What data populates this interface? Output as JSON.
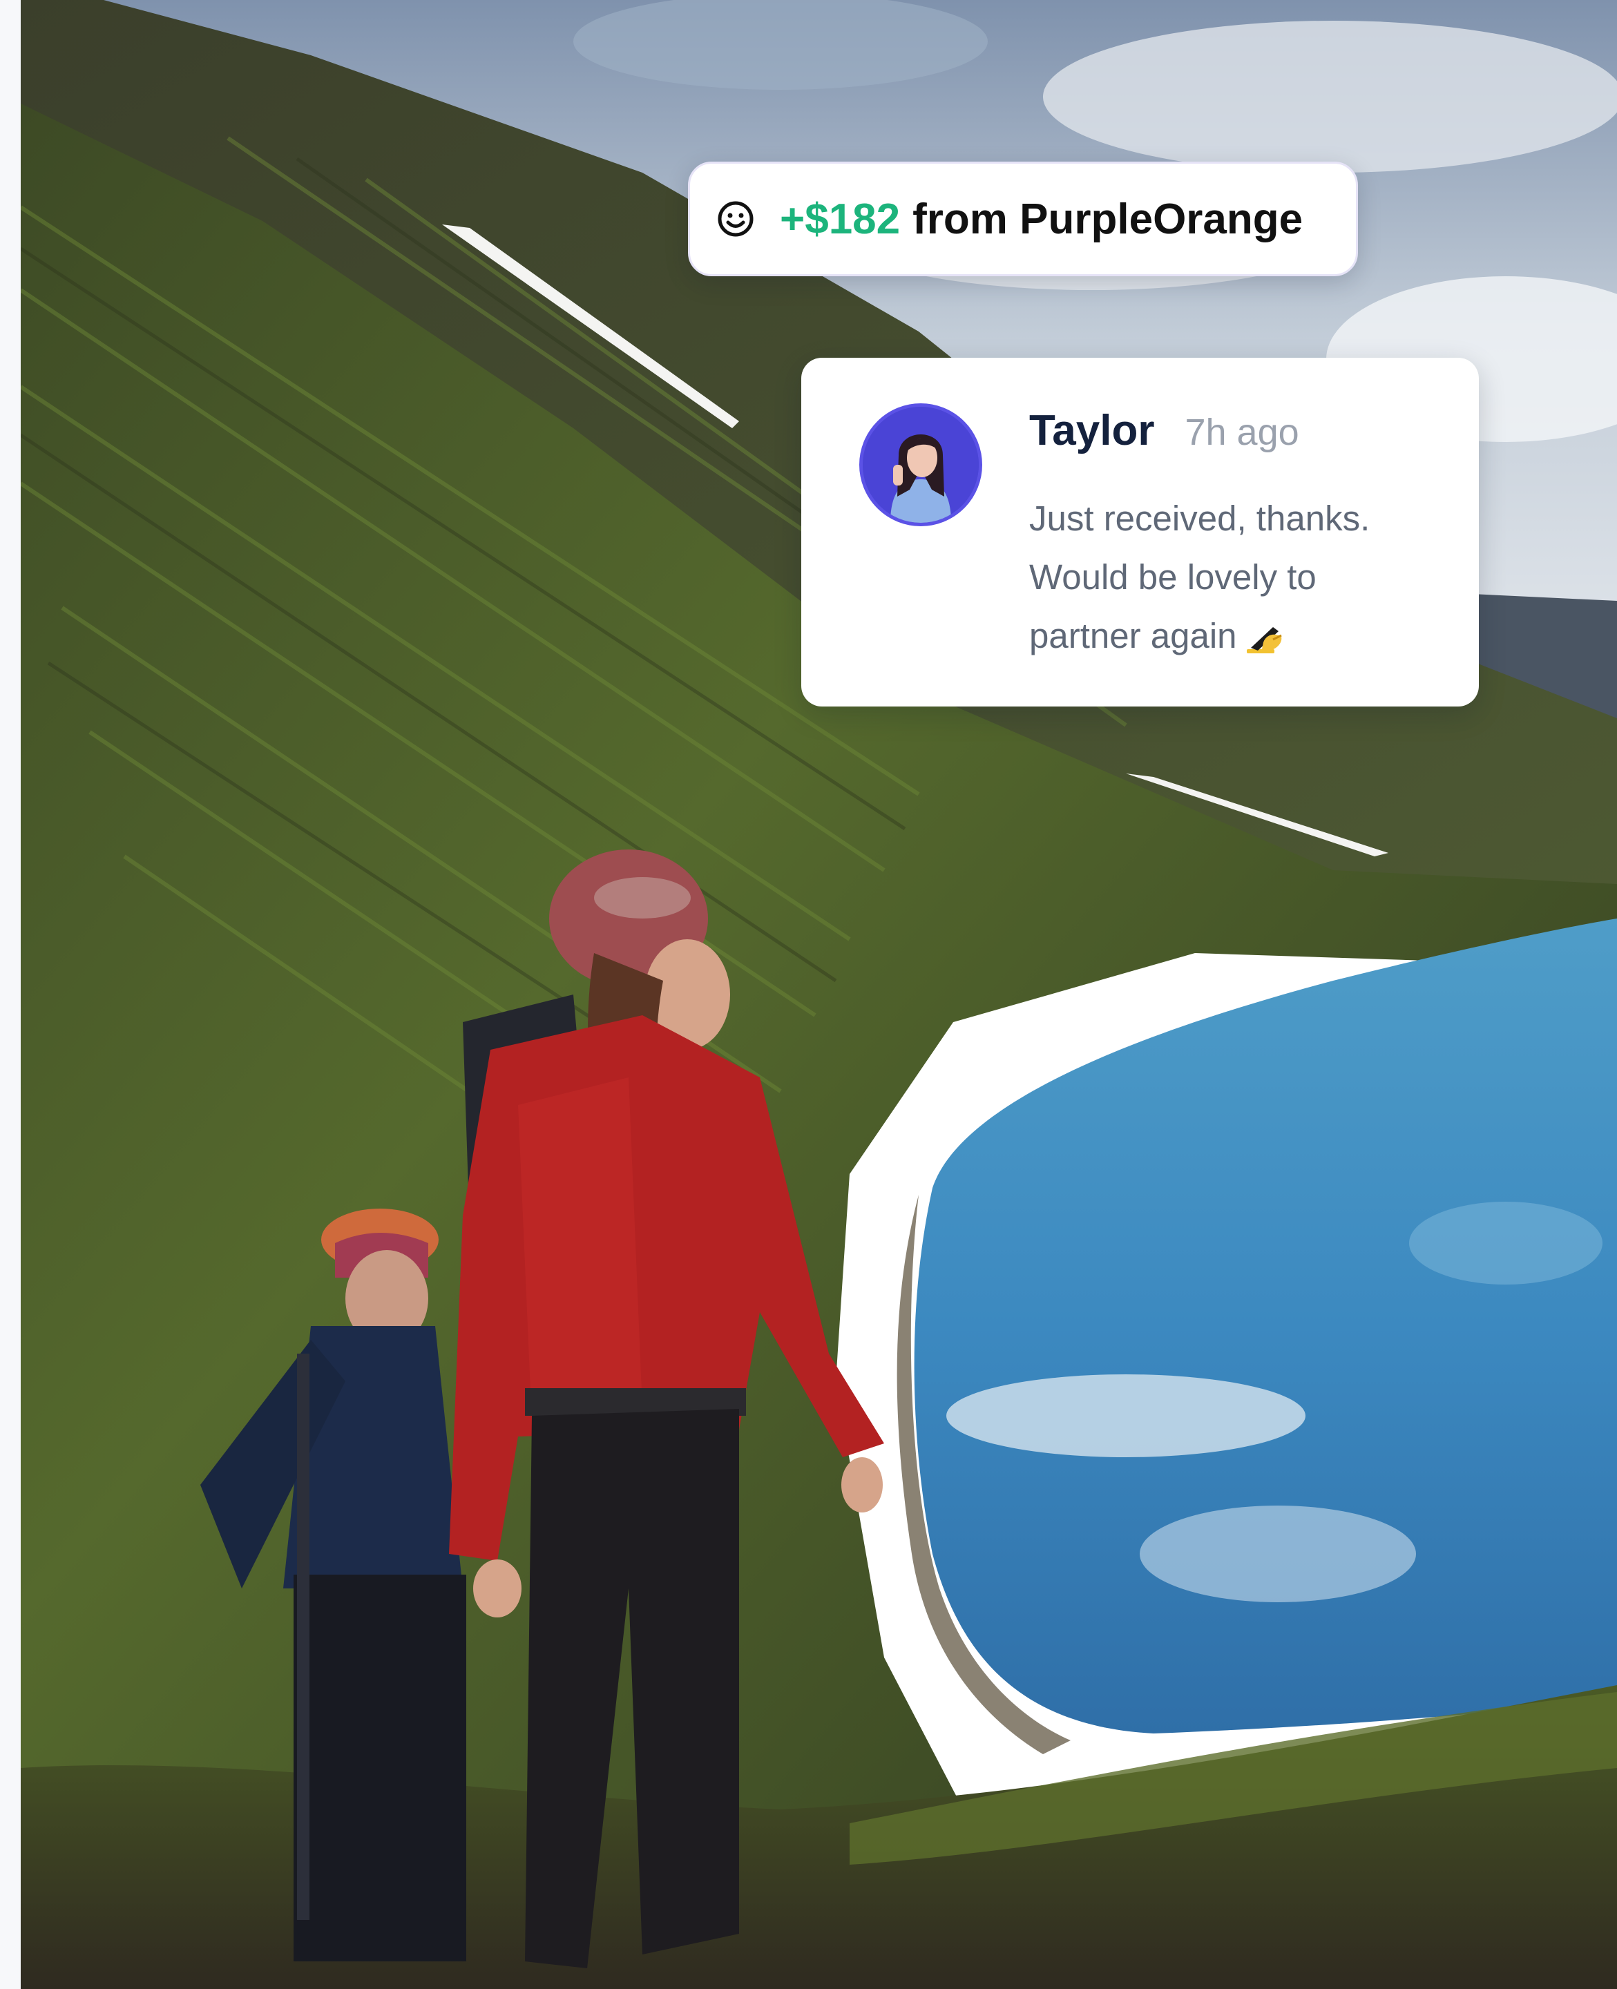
{
  "notification": {
    "icon": "smile-icon",
    "amount": "+$182",
    "text": "from PurpleOrange",
    "amount_color": "#1cb47c"
  },
  "message": {
    "name": "Taylor",
    "time": "7h ago",
    "lines": [
      "Just received, thanks.",
      "Would be lovely to",
      "partner again"
    ],
    "emoji": "writing-hand-icon",
    "avatar": "avatar"
  },
  "colors": {
    "accent_green": "#1cb47c",
    "avatar_ring": "#5b52e6",
    "name_color": "#14213d",
    "message_color": "#5f6877"
  }
}
